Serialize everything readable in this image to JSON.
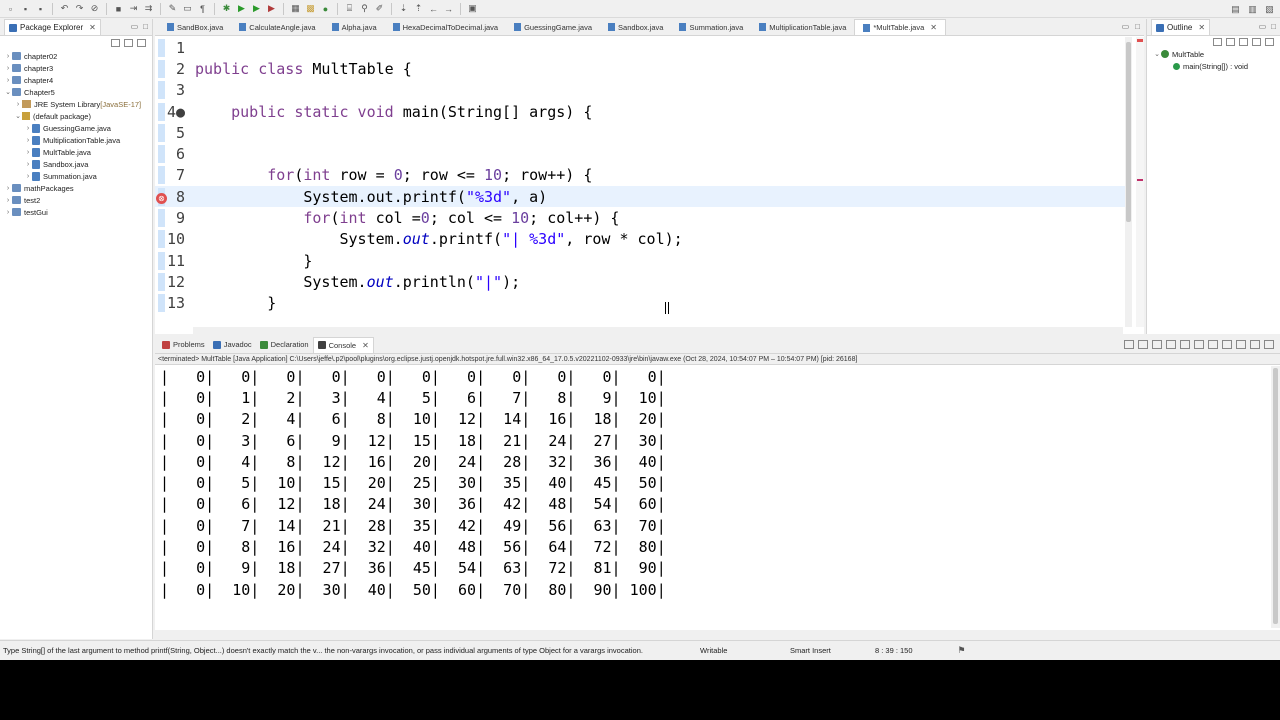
{
  "package_explorer": {
    "tab_label": "Package Explorer",
    "tree": [
      {
        "label": "chapter02",
        "indent": 0,
        "twisty": "›",
        "icon": "project"
      },
      {
        "label": "chapter3",
        "indent": 0,
        "twisty": "›",
        "icon": "project"
      },
      {
        "label": "chapter4",
        "indent": 0,
        "twisty": "›",
        "icon": "project"
      },
      {
        "label": "Chapter5",
        "indent": 0,
        "twisty": "⌄",
        "icon": "project"
      },
      {
        "label": "JRE System Library",
        "suffix": " [JavaSE-17]",
        "indent": 1,
        "twisty": "›",
        "icon": "jar"
      },
      {
        "label": "(default package)",
        "indent": 1,
        "twisty": "⌄",
        "icon": "package"
      },
      {
        "label": "GuessingGame.java",
        "indent": 2,
        "twisty": "›",
        "icon": "java"
      },
      {
        "label": "MultiplicationTable.java",
        "indent": 2,
        "twisty": "›",
        "icon": "java"
      },
      {
        "label": "MultTable.java",
        "indent": 2,
        "twisty": "›",
        "icon": "java"
      },
      {
        "label": "Sandbox.java",
        "indent": 2,
        "twisty": "›",
        "icon": "java"
      },
      {
        "label": "Summation.java",
        "indent": 2,
        "twisty": "›",
        "icon": "java"
      },
      {
        "label": "mathPackages",
        "indent": 0,
        "twisty": "›",
        "icon": "project"
      },
      {
        "label": "test2",
        "indent": 0,
        "twisty": "›",
        "icon": "project"
      },
      {
        "label": "testGui",
        "indent": 0,
        "twisty": "›",
        "icon": "project"
      }
    ]
  },
  "editor": {
    "tabs": [
      "SandBox.java",
      "CalculateAngle.java",
      "Alpha.java",
      "HexaDecimalToDecimal.java",
      "GuessingGame.java",
      "Sandbox.java",
      "Summation.java",
      "MultiplicationTable.java",
      "*MultTable.java"
    ],
    "active_tab_index": 8,
    "lines": [
      {
        "n": "1",
        "tokens": []
      },
      {
        "n": "2",
        "tokens": [
          [
            "kw",
            "public class "
          ],
          [
            "txt",
            "MultTable {"
          ]
        ]
      },
      {
        "n": "3",
        "tokens": []
      },
      {
        "n": "4●",
        "tokens": [
          [
            "txt",
            "    "
          ],
          [
            "kw",
            "public static void "
          ],
          [
            "txt",
            "main(String[] args) {"
          ]
        ]
      },
      {
        "n": "5",
        "tokens": []
      },
      {
        "n": "6",
        "tokens": []
      },
      {
        "n": "7",
        "tokens": [
          [
            "txt",
            "        "
          ],
          [
            "kw",
            "for"
          ],
          [
            "txt",
            "("
          ],
          [
            "kw",
            "int "
          ],
          [
            "txt",
            "row = "
          ],
          [
            "num",
            "0"
          ],
          [
            "txt",
            "; row <= "
          ],
          [
            "num",
            "10"
          ],
          [
            "txt",
            "; row++) {"
          ]
        ]
      },
      {
        "n": "8",
        "tokens": [
          [
            "txt",
            "            System.out.printf("
          ],
          [
            "str",
            "\"%3d\""
          ],
          [
            "txt",
            ", a)"
          ]
        ],
        "current": true,
        "error": true
      },
      {
        "n": "9",
        "tokens": [
          [
            "txt",
            "            "
          ],
          [
            "kw",
            "for"
          ],
          [
            "txt",
            "("
          ],
          [
            "kw",
            "int "
          ],
          [
            "txt",
            "col ="
          ],
          [
            "num",
            "0"
          ],
          [
            "txt",
            "; col <= "
          ],
          [
            "num",
            "10"
          ],
          [
            "txt",
            "; col++) {"
          ]
        ]
      },
      {
        "n": "10",
        "tokens": [
          [
            "txt",
            "                System."
          ],
          [
            "fld",
            "out"
          ],
          [
            "txt",
            ".printf("
          ],
          [
            "str",
            "\"| %3d\""
          ],
          [
            "txt",
            ", row * col);"
          ]
        ]
      },
      {
        "n": "11",
        "tokens": [
          [
            "txt",
            "            }"
          ]
        ]
      },
      {
        "n": "12",
        "tokens": [
          [
            "txt",
            "            System."
          ],
          [
            "fld",
            "out"
          ],
          [
            "txt",
            ".println("
          ],
          [
            "str",
            "\"|\""
          ],
          [
            "txt",
            ");"
          ]
        ]
      },
      {
        "n": "13",
        "tokens": [
          [
            "txt",
            "        }"
          ]
        ]
      }
    ]
  },
  "outline": {
    "tab_label": "Outline",
    "class_name": "MultTable",
    "method": "main(String[]) : void"
  },
  "console": {
    "tabs": [
      "Problems",
      "Javadoc",
      "Declaration",
      "Console"
    ],
    "active_tab_index": 3,
    "terminated_line": "<terminated> MultTable [Java Application] C:\\Users\\jeffe\\.p2\\pool\\plugins\\org.eclipse.justj.openjdk.hotspot.jre.full.win32.x86_64_17.0.5.v20221102-0933\\jre\\bin\\javaw.exe (Oct 28, 2024, 10:54:07 PM – 10:54:07 PM) [pid: 26168]",
    "rows": [
      "|   0|   0|   0|   0|   0|   0|   0|   0|   0|   0|   0|",
      "|   0|   1|   2|   3|   4|   5|   6|   7|   8|   9|  10|",
      "|   0|   2|   4|   6|   8|  10|  12|  14|  16|  18|  20|",
      "|   0|   3|   6|   9|  12|  15|  18|  21|  24|  27|  30|",
      "|   0|   4|   8|  12|  16|  20|  24|  28|  32|  36|  40|",
      "|   0|   5|  10|  15|  20|  25|  30|  35|  40|  45|  50|",
      "|   0|   6|  12|  18|  24|  30|  36|  42|  48|  54|  60|",
      "|   0|   7|  14|  21|  28|  35|  42|  49|  56|  63|  70|",
      "|   0|   8|  16|  24|  32|  40|  48|  56|  64|  72|  80|",
      "|   0|   9|  18|  27|  36|  45|  54|  63|  72|  81|  90|",
      "|   0|  10|  20|  30|  40|  50|  60|  70|  80|  90| 100|"
    ]
  },
  "status": {
    "message": "Type String[] of the last argument to method printf(String, Object...) doesn't exactly match the v... the non-varargs invocation, or pass individual arguments of type Object for a varargs invocation.",
    "writable": "Writable",
    "insert_mode": "Smart Insert",
    "position": "8 : 39 : 150"
  },
  "colors": {
    "keyword": "#7f3f8f",
    "string": "#2a00ff",
    "field": "#0000c0",
    "current_line": "#e8f2fe",
    "error": "#e05050"
  }
}
